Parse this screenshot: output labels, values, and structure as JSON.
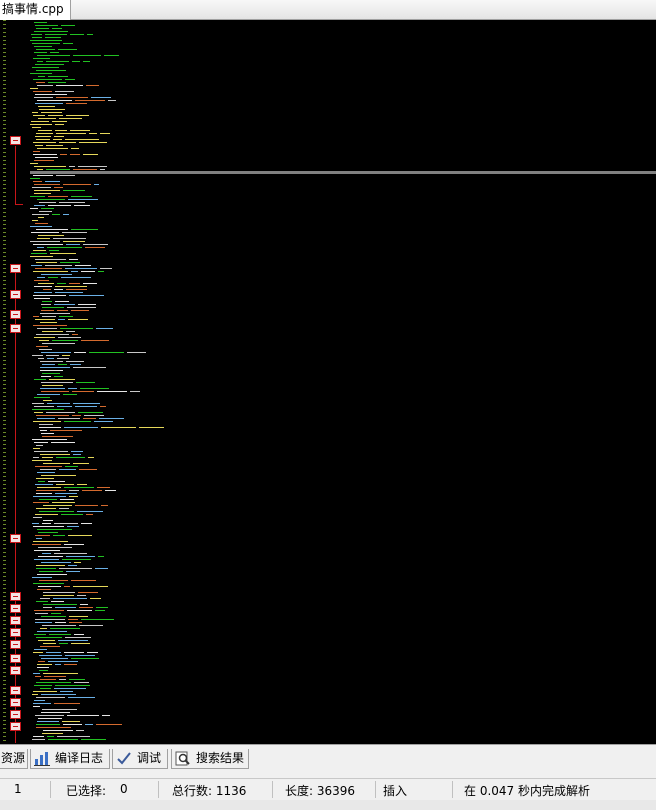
{
  "file_tab": {
    "title": "搞事情.cpp"
  },
  "editor": {
    "background": "#000000",
    "palette": [
      "#22c122",
      "#e6d85a",
      "#d46a2e",
      "#e6e6e6",
      "#6ab0e6",
      "#c8c8c8"
    ],
    "fold_color": "#c8161a"
  },
  "bottom_tabs": [
    {
      "label": "资源",
      "icon": "resource-icon"
    },
    {
      "label": "编译日志",
      "icon": "bar-chart-icon"
    },
    {
      "label": "调试",
      "icon": "checkmark-icon"
    },
    {
      "label": "搜索结果",
      "icon": "search-results-icon"
    }
  ],
  "status": {
    "line": "1",
    "selected_label": "已选择:",
    "selected_value": "0",
    "total_lines": "总行数:  1136",
    "length": "长度: 36396",
    "mode": "插入",
    "parse_time": "在 0.047 秒内完成解析"
  }
}
